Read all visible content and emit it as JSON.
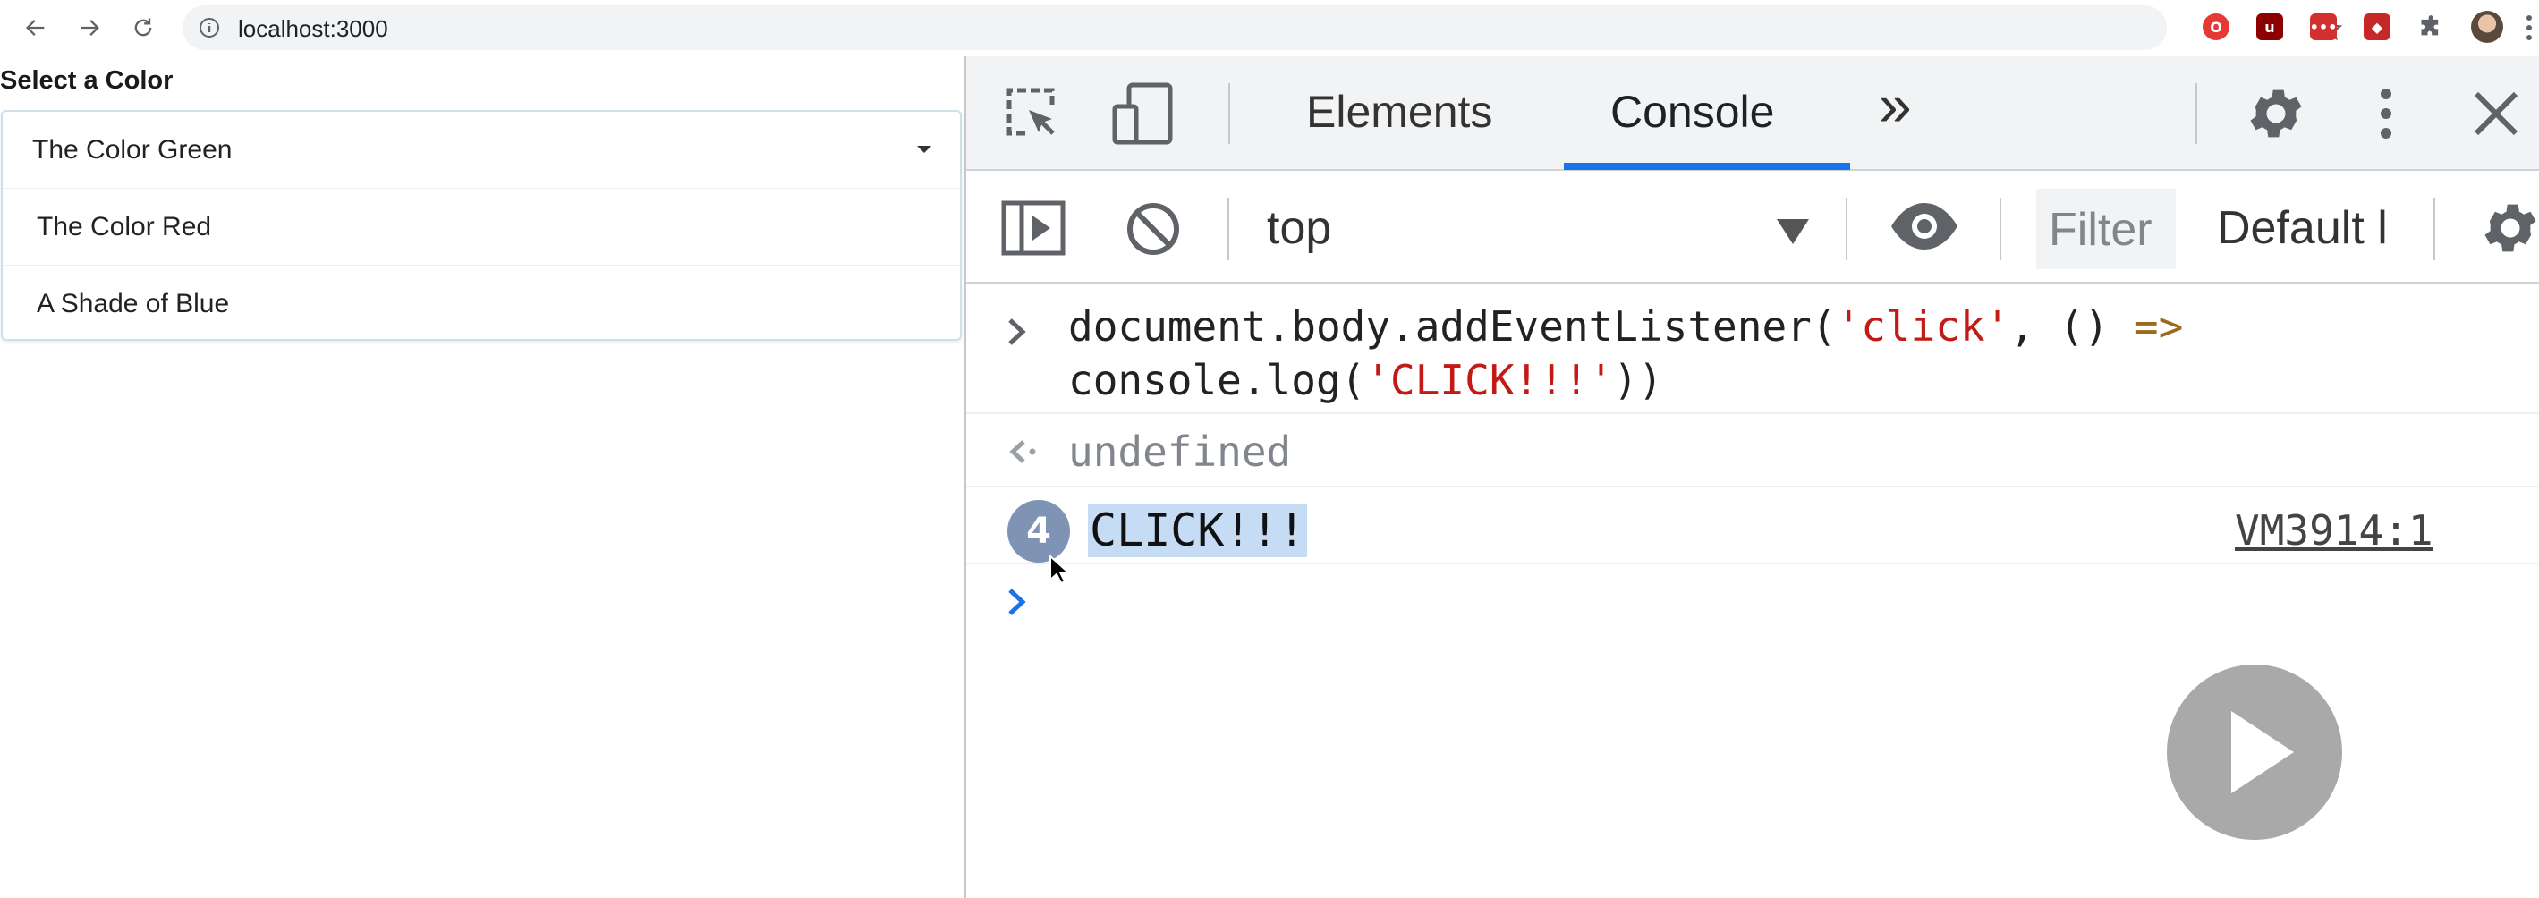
{
  "browser": {
    "url": "localhost:3000",
    "icons": [
      "back-icon",
      "forward-icon",
      "reload-icon",
      "info-icon",
      "zoom-icon",
      "star-icon",
      "extension-icons",
      "puzzle-icon",
      "avatar",
      "more-icon"
    ]
  },
  "page": {
    "select_label": "Select a Color",
    "selected_value": "The Color Green",
    "options": [
      {
        "label": "The Color Red"
      },
      {
        "label": "A Shade of Blue"
      }
    ]
  },
  "devtools": {
    "tabs": {
      "elements": "Elements",
      "console": "Console"
    },
    "overflow_tabs": "»",
    "context": "top",
    "filter_placeholder": "Filter",
    "log_levels": "Default l",
    "accent_color": "#1a73e8"
  },
  "console": {
    "input_line1_plain": "document.body.addEventListener(",
    "input_line1_string": "'click'",
    "input_line1_mid": ", () ",
    "input_line1_arrow": "=>",
    "input_line2_plain": "console.log(",
    "input_line2_string": "'CLICK!!!'",
    "input_line2_end": "))",
    "result": "undefined",
    "log_count": "4",
    "log_message": "CLICK!!!",
    "log_source": "VM3914:1"
  }
}
